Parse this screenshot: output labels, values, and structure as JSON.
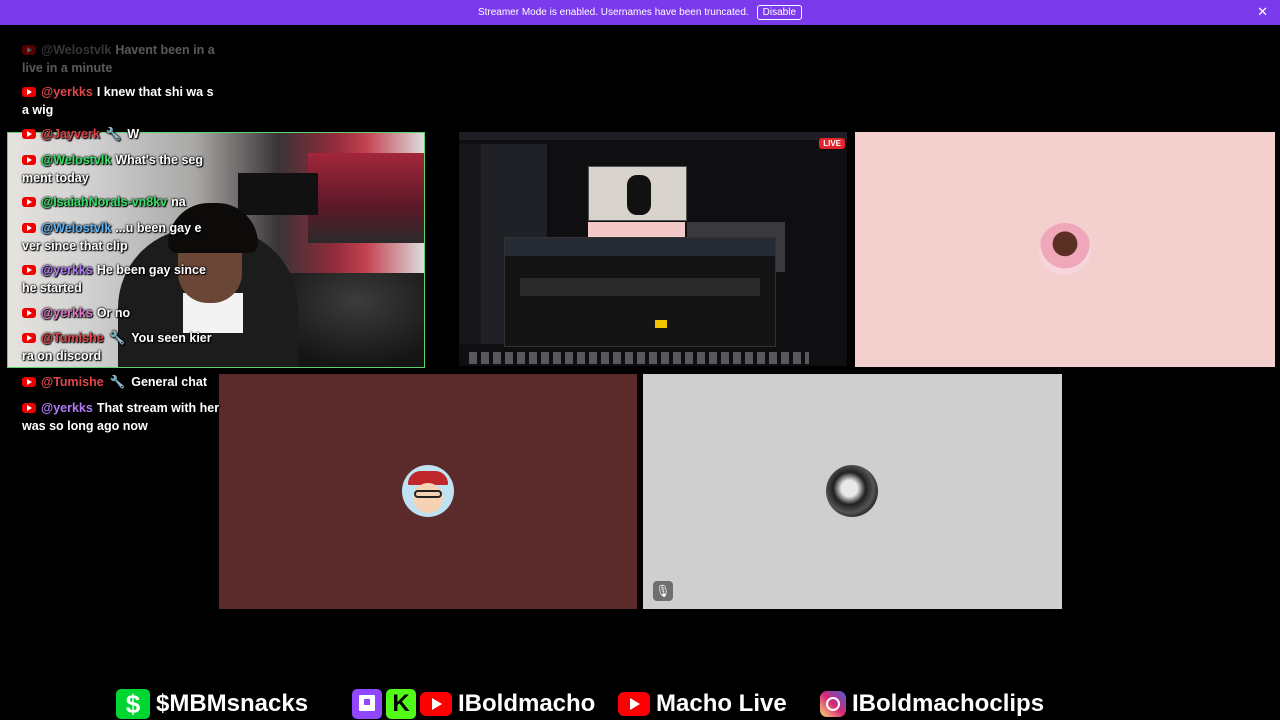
{
  "banner": {
    "message": "Streamer Mode is enabled. Usernames have been truncated.",
    "button_label": "Disable",
    "close_glyph": "✕"
  },
  "chat": {
    "messages": [
      {
        "user": "@Welostvlk",
        "text": "Havent been in a live in a minute",
        "user_color": "#9a9a9a"
      },
      {
        "user": "@yerkks",
        "text": "I knew that shi wa s a wig",
        "user_color": "#e0454a"
      },
      {
        "user": "@Jayverk",
        "badge": "🔧",
        "text": "W",
        "user_color": "#e0454a"
      },
      {
        "user": "@Welostvlk",
        "text": "What's the seg ment today",
        "user_color": "#39e06a"
      },
      {
        "user": "@IsaiahNorals-vn8kv",
        "text": "na",
        "user_color": "#39e06a"
      },
      {
        "user": "@Welostvlk",
        "text": "...u been gay e ver since that clip",
        "user_color": "#5fb3f5"
      },
      {
        "user": "@yerkks",
        "text": "He been gay since he started",
        "user_color": "#b07cf5"
      },
      {
        "user": "@yerkks",
        "text": "Or no",
        "user_color": "#e07ac8"
      },
      {
        "user": "@Tumishe",
        "badge": "🔧",
        "text": "You seen kier ra on discord",
        "user_color": "#e0454a"
      },
      {
        "user": "@Tumishe",
        "badge": "🔧",
        "text": "General chat",
        "user_color": "#e0454a"
      },
      {
        "user": "@yerkks",
        "text": "That stream with her was so long ago now",
        "user_color": "#b07cf5"
      }
    ]
  },
  "screen_share": {
    "live_label": "LIVE"
  },
  "tiles": {
    "mute_glyph": "🎙"
  },
  "socials": [
    {
      "icon": "cash-app-icon",
      "glyph": "$",
      "label": "$MBMsnacks"
    },
    {
      "icon": "twitch-icon",
      "glyph": "",
      "label": ""
    },
    {
      "icon": "kick-icon",
      "glyph": "K",
      "label": ""
    },
    {
      "icon": "youtube-icon",
      "glyph": "",
      "label": "IBoldmacho"
    },
    {
      "icon": "youtube-icon",
      "glyph": "",
      "label": "Macho Live"
    },
    {
      "icon": "instagram-icon",
      "glyph": "",
      "label": "IBoldmachoclips"
    }
  ],
  "colors": {
    "banner": "#7c3aed",
    "pink_tile": "#f3cfcd",
    "maroon_tile": "#5b2b2b",
    "gray_tile": "#cfcfcf",
    "webcam_border": "#5bd36e"
  }
}
